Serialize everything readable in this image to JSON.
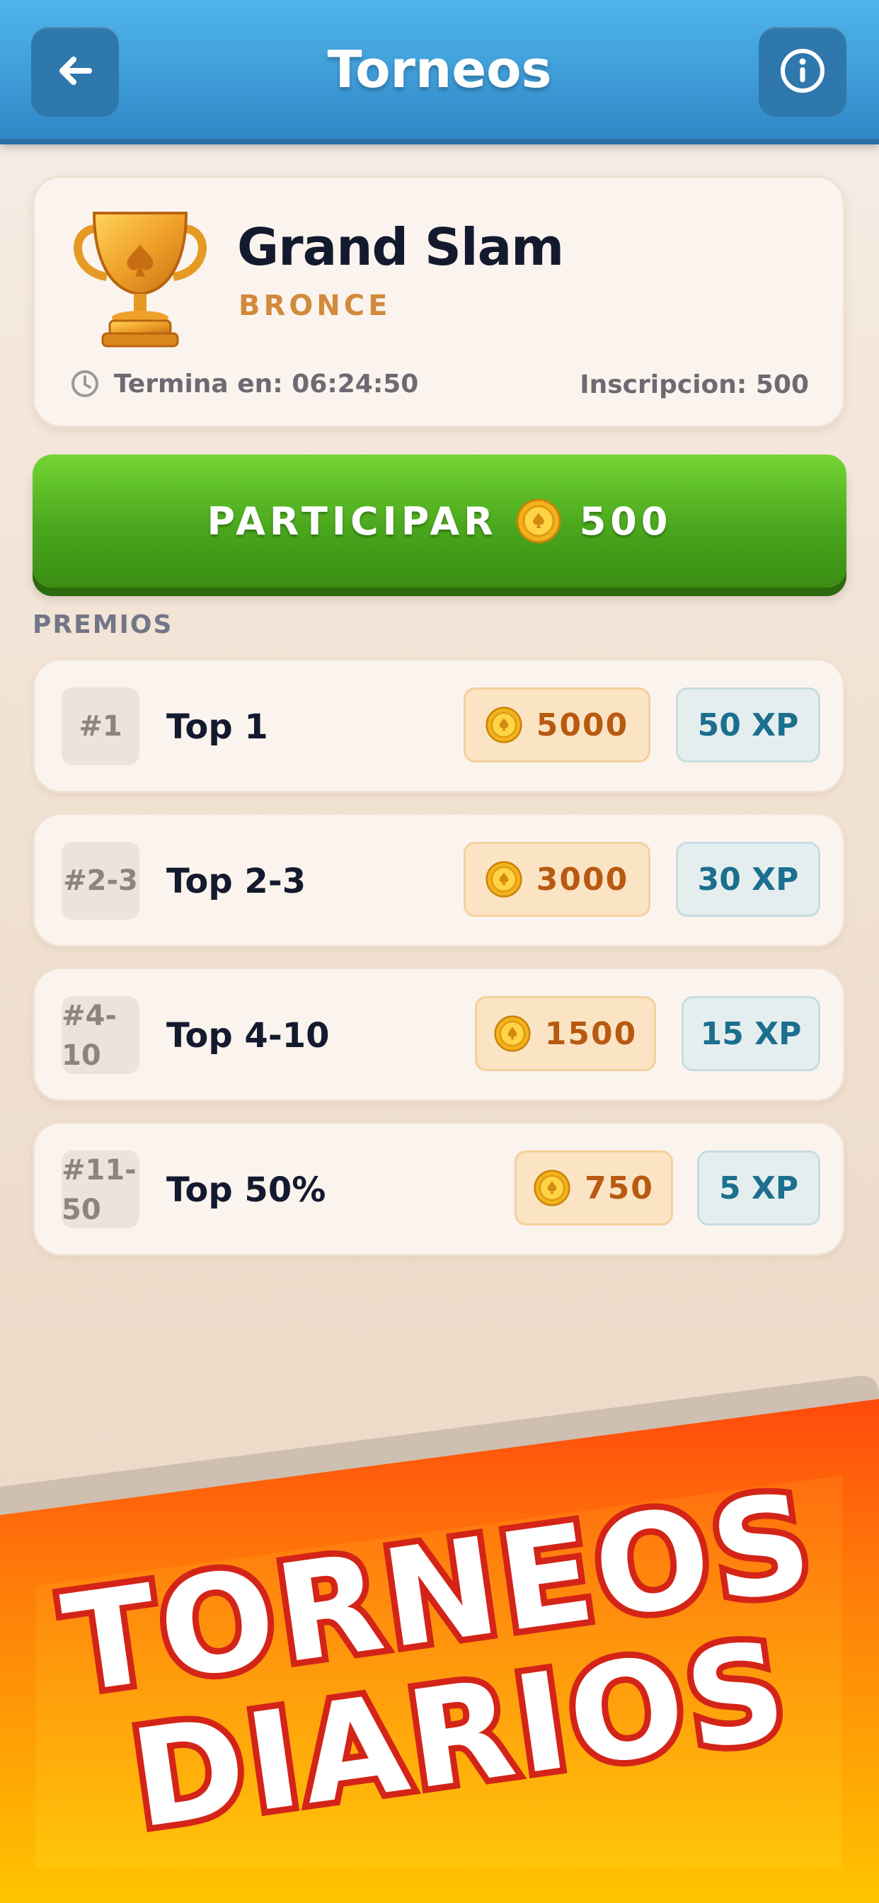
{
  "header": {
    "title": "Torneos",
    "back_icon": "arrow-left-icon",
    "info_icon": "info-icon"
  },
  "tournament": {
    "name": "Grand Slam",
    "tier": "BRONCE",
    "ends_label": "Termina en: 06:24:50",
    "entry_label": "Inscripcion: 500",
    "tier_color": "#d28a3c"
  },
  "join": {
    "label": "PARTICIPAR",
    "price": "500",
    "color": "#4aa71d"
  },
  "prizes": {
    "section_label": "PREMIOS",
    "rows": [
      {
        "rank": "#1",
        "label": "Top 1",
        "coins": "5000",
        "xp": "50 XP"
      },
      {
        "rank": "#2-3",
        "label": "Top 2-3",
        "coins": "3000",
        "xp": "30 XP"
      },
      {
        "rank": "#4-10",
        "label": "Top 4-10",
        "coins": "1500",
        "xp": "15 XP"
      },
      {
        "rank": "#11-50",
        "label": "Top 50%",
        "coins": "750",
        "xp": "5 XP"
      }
    ]
  },
  "promo": {
    "line1": "TORNEOS",
    "line2": "DIARIOS"
  }
}
